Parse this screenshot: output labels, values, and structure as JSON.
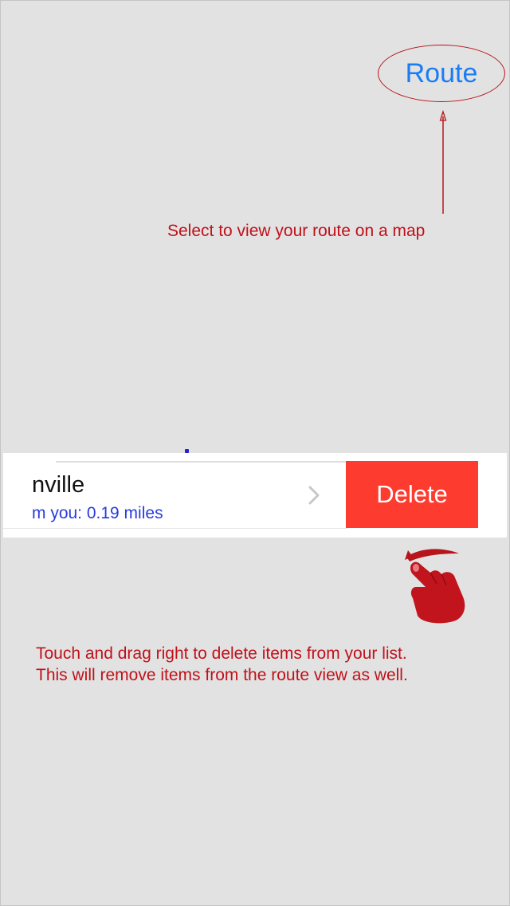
{
  "route_button": {
    "label": "Route"
  },
  "route_caption": "Select to view your route on a map",
  "list_item": {
    "title": "nville",
    "subtitle": "m you: 0.19 miles",
    "delete_label": "Delete"
  },
  "delete_caption": {
    "line1": "Touch and drag right to delete items from your list.",
    "line2": "This will remove items from the route view as well."
  },
  "icons": {
    "chevron": "chevron-right-icon",
    "hand": "swipe-hand-icon"
  },
  "colors": {
    "background": "#e2e2e2",
    "annotation_red": "#c0111a",
    "link_blue": "#1a7cf5",
    "subtitle_blue": "#2a3bdc",
    "delete_red": "#fd3b2f"
  }
}
